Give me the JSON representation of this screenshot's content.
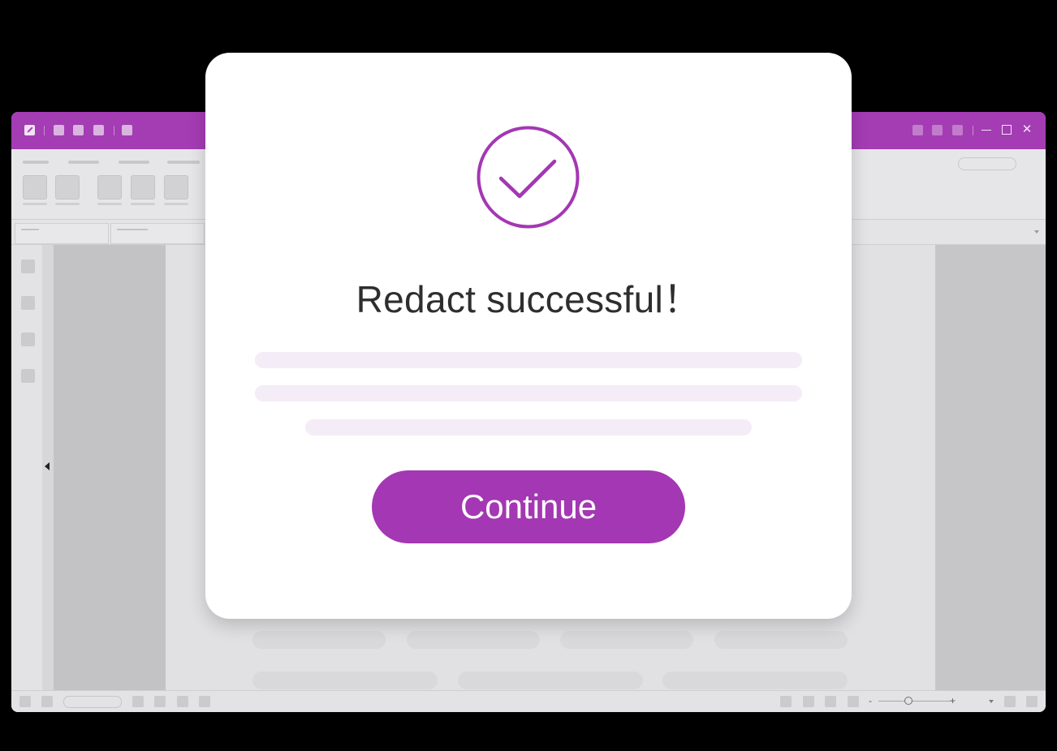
{
  "colors": {
    "brand": "#a437b3",
    "titlebar": "#a43cb4",
    "background": "#000000",
    "dialog_background": "#ffffff",
    "placeholder_line": "#f4ecf6",
    "title_text": "#2e2e2e"
  },
  "icons": {
    "logo": "app-logo-icon",
    "success": "checkmark-circle-icon",
    "minimize": "minimize-icon",
    "maximize": "maximize-icon",
    "close": "close-icon",
    "collapse": "chevron-left-icon"
  },
  "window_controls": {
    "close_glyph": "✕"
  },
  "status_bar": {
    "zoom_minus": "-",
    "zoom_plus": "+"
  },
  "dialog": {
    "title": "Redact successful！",
    "button_label": "Continue"
  }
}
